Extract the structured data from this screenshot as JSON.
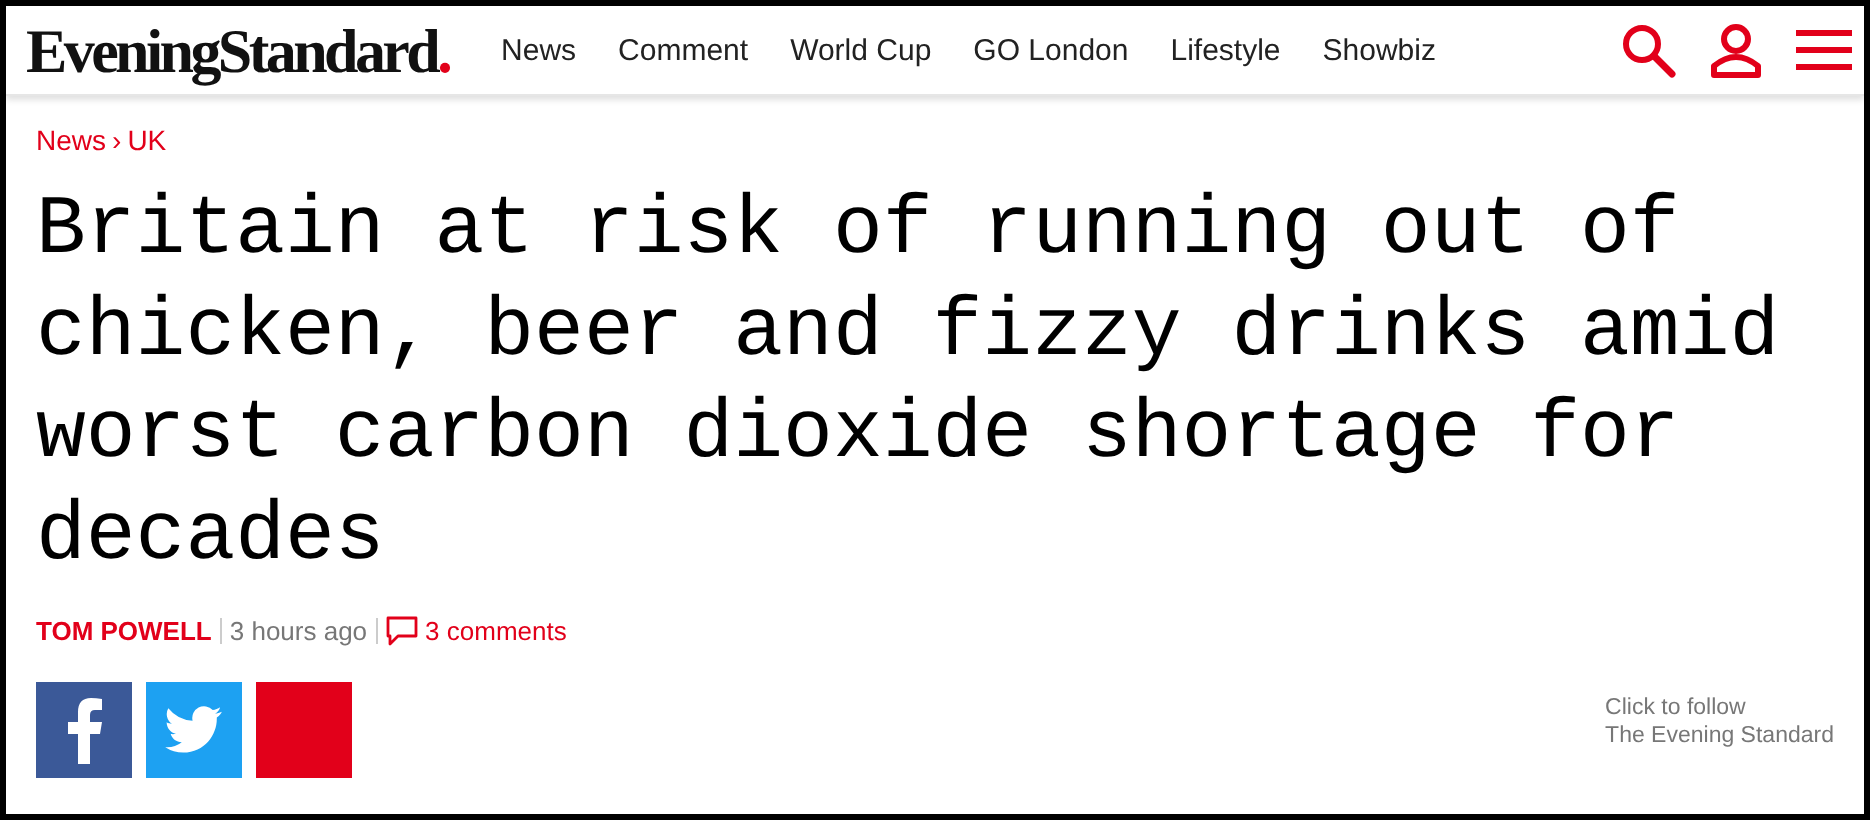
{
  "logo": {
    "name": "EveningStandard",
    "dot": "."
  },
  "nav": [
    "News",
    "Comment",
    "World Cup",
    "GO London",
    "Lifestyle",
    "Showbiz"
  ],
  "breadcrumb": [
    {
      "label": "News"
    },
    {
      "label": "UK"
    }
  ],
  "breadcrumb_separator": "›",
  "headline": "Britain at risk of running out of chicken, beer and fizzy drinks amid worst carbon dioxide shortage for decades",
  "byline": {
    "author": "TOM POWELL",
    "time": "3 hours ago",
    "comments": "3 comments"
  },
  "share": [
    {
      "kind": "facebook",
      "color": "#3b5998"
    },
    {
      "kind": "twitter",
      "color": "#1da1f2"
    },
    {
      "kind": "plain",
      "color": "#e2001a"
    }
  ],
  "follow": [
    "Click to follow",
    "The Evening Standard"
  ]
}
